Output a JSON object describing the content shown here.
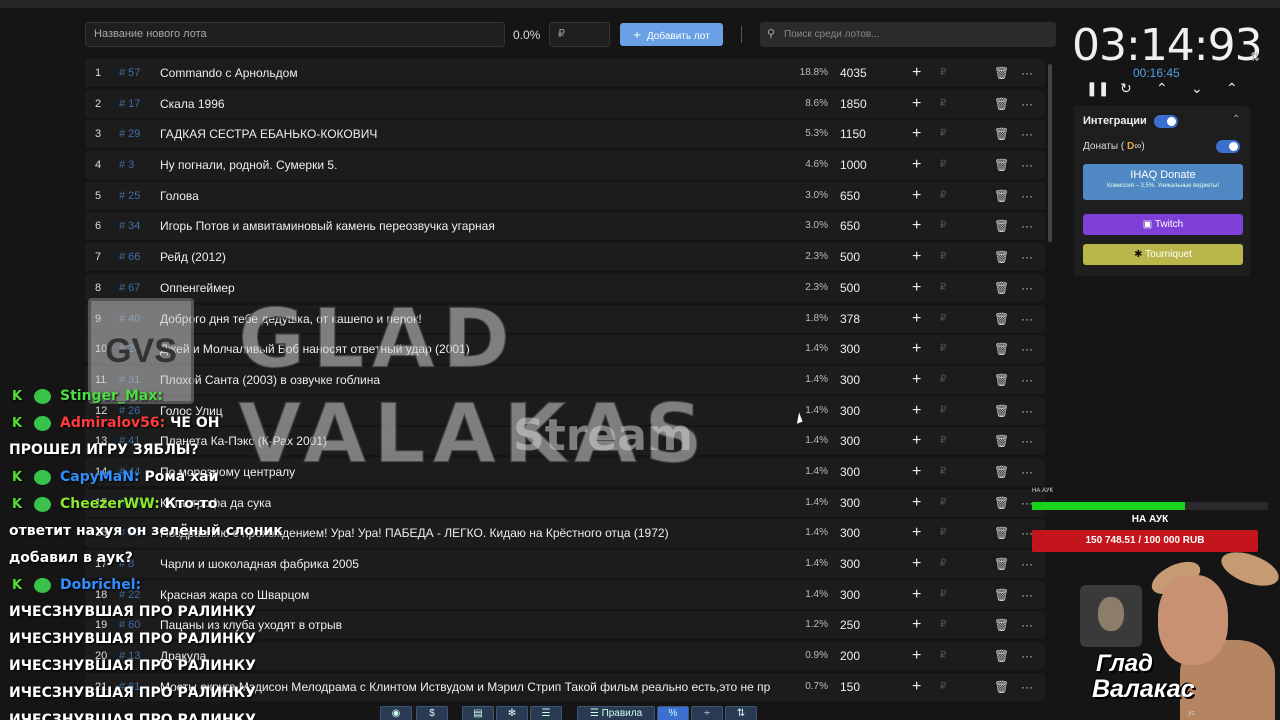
{
  "toolbar": {
    "lot_placeholder": "Название нового лота",
    "percent": "0.0%",
    "currency": "₽",
    "add_label": "Добавить лот",
    "search_placeholder": "Поиск среди лотов..."
  },
  "lots": [
    {
      "n": "1",
      "id": "# 57",
      "name": "Commando с Арнольдом",
      "pct": "18.8%",
      "amount": "4035"
    },
    {
      "n": "2",
      "id": "# 17",
      "name": "Скала 1996",
      "pct": "8.6%",
      "amount": "1850"
    },
    {
      "n": "3",
      "id": "# 29",
      "name": "ГАДКАЯ СЕСТРА ЕБАНЬКО-КОКОВИЧ",
      "pct": "5.3%",
      "amount": "1150"
    },
    {
      "n": "4",
      "id": "# 3",
      "name": "Ну погнали, родной. Сумерки 5.",
      "pct": "4.6%",
      "amount": "1000"
    },
    {
      "n": "5",
      "id": "# 25",
      "name": "Голова",
      "pct": "3.0%",
      "amount": "650"
    },
    {
      "n": "6",
      "id": "# 34",
      "name": "Игорь Потов и амвитаминовый камень переозвучка угарная",
      "pct": "3.0%",
      "amount": "650"
    },
    {
      "n": "7",
      "id": "# 66",
      "name": "Рейд (2012)",
      "pct": "2.3%",
      "amount": "500"
    },
    {
      "n": "8",
      "id": "# 67",
      "name": "Оппенгеймер",
      "pct": "2.3%",
      "amount": "500"
    },
    {
      "n": "9",
      "id": "# 40",
      "name": "Доброго дня тебе дедушка, от кашепо и перок!",
      "pct": "1.8%",
      "amount": "378"
    },
    {
      "n": "10",
      "id": "# 20",
      "name": "Джей и Молчаливый Боб наносят ответный удар (2001)",
      "pct": "1.4%",
      "amount": "300"
    },
    {
      "n": "11",
      "id": "# 31",
      "name": "Плохой Санта (2003) в озвучке гоблина",
      "pct": "1.4%",
      "amount": "300"
    },
    {
      "n": "12",
      "id": "# 26",
      "name": "Голос Улиц",
      "pct": "1.4%",
      "amount": "300"
    },
    {
      "n": "13",
      "id": "# 41",
      "name": "Планета Ка-Пэкс (К-Рах 2001)",
      "pct": "1.4%",
      "amount": "300"
    },
    {
      "n": "14",
      "id": "# 44",
      "name": "По морозному централу",
      "pct": "1.4%",
      "amount": "300"
    },
    {
      "n": "15",
      "id": "# 46",
      "name": "Катастрофа да сука",
      "pct": "1.4%",
      "amount": "300"
    },
    {
      "n": "16",
      "id": "# 53",
      "name": "Поздравляю с прохождением! Ура! Ура! ПАБЕДА - ЛЕГКО. Кидаю на Крёстного отца (1972)",
      "pct": "1.4%",
      "amount": "300"
    },
    {
      "n": "17",
      "id": "# 8",
      "name": "Чарли и шоколадная фабрика 2005",
      "pct": "1.4%",
      "amount": "300"
    },
    {
      "n": "18",
      "id": "# 22",
      "name": "Красная жара со Шварцом",
      "pct": "1.4%",
      "amount": "300"
    },
    {
      "n": "19",
      "id": "# 60",
      "name": "Пацаны из клуба уходят в отрыв",
      "pct": "1.2%",
      "amount": "250"
    },
    {
      "n": "20",
      "id": "# 13",
      "name": "Дракула",
      "pct": "0.9%",
      "amount": "200"
    },
    {
      "n": "21",
      "id": "# 61",
      "name": "Мосты округа Мэдисон Мелодрама с Клинтом Иствудом и Мэрил Стрип Такой фильм реально есть,это не пр",
      "pct": "0.7%",
      "amount": "150"
    }
  ],
  "timer": {
    "main": "03:14:93",
    "sub": "00:16:45"
  },
  "integrations": {
    "title": "Интеграции",
    "donations_label": "Донаты (",
    "ihaq_title": "IHAQ Donate",
    "ihaq_sub": "Комиссия – 3,5%. Уникальные виджеты!",
    "twitch": "Twitch",
    "tourniquet": "Tourniquet"
  },
  "bottombar": {
    "rules": "Правила"
  },
  "watermark": {
    "logo": "GVS",
    "title": "GLAD VALAKAS",
    "sub": "Stream"
  },
  "chat": [
    {
      "user": "Stinger_Max:",
      "color": "#4ddd44",
      "text": ""
    },
    {
      "user": "Admiralov56:",
      "color": "#ff3a3a",
      "text": "ЧЕ ОН"
    },
    {
      "msg": "ПРОШЕЛ ИГРУ ЗЯБЛЫ?"
    },
    {
      "user": "CapyMaN:",
      "color": "#2f8fff",
      "text": "Рома хай"
    },
    {
      "user": "CheezerWW:",
      "color": "#8bea2f",
      "text": "Кто-то"
    },
    {
      "msg": "ответит нахуя он зелёный слоник"
    },
    {
      "msg": "добавил в аук?"
    },
    {
      "user": "Dobrichel:",
      "color": "#2f8fff",
      "text": ""
    },
    {
      "msg": "ИЧЕСЗНУВШАЯ ПРО РАЛИНКУ"
    },
    {
      "msg": "ИЧЕСЗНУВШАЯ ПРО РАЛИНКУ"
    },
    {
      "msg": "ИЧЕСЗНУВШАЯ ПРО РАЛИНКУ"
    },
    {
      "msg": "ИЧЕСЗНУВШАЯ ПРО РАЛИНКУ"
    },
    {
      "msg": "ИЧЕСЗНУВШАЯ ПРО РАЛИНКУ"
    }
  ],
  "progress": {
    "small_label": "НА АУК",
    "label": "НА АУК",
    "amount": "150 748.51 / 100 000 RUB",
    "fill_fraction": 0.65
  },
  "streamer": {
    "line1": "Глад",
    "line2": "Валакас",
    "tag": "ус"
  }
}
